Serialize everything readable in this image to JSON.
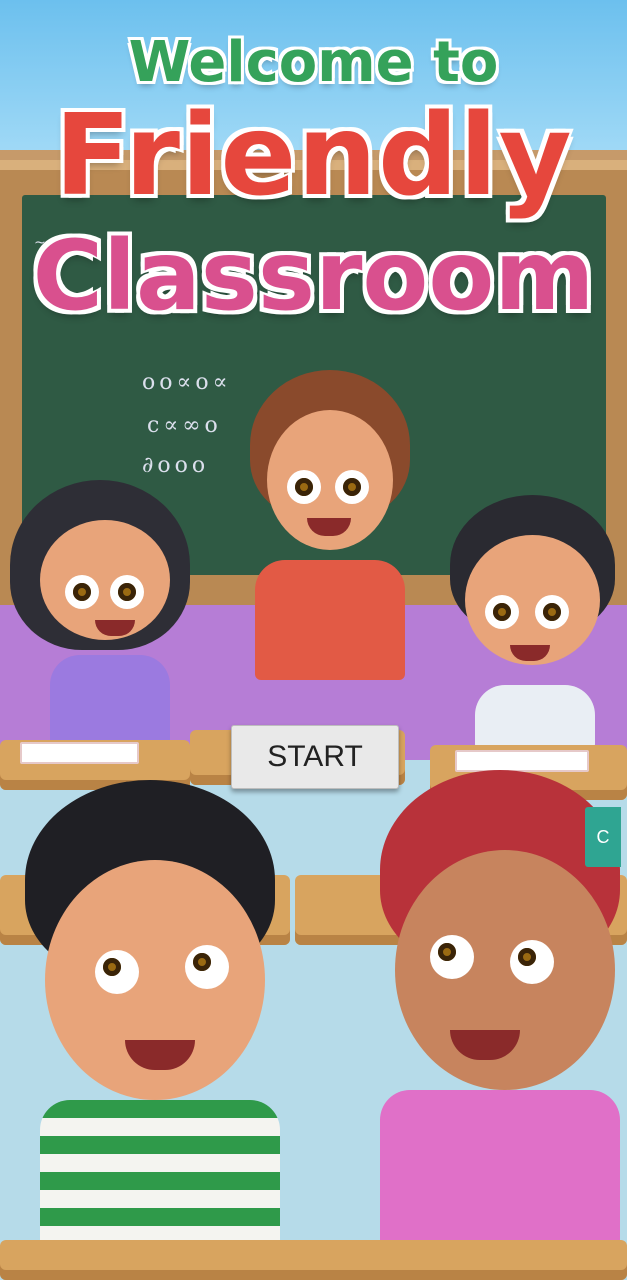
{
  "screen": {
    "title_line1": "Welcome to",
    "title_line2": "Friendly",
    "title_line3": "Classroom"
  },
  "actions": {
    "start_label": "START",
    "side_label": "C"
  },
  "colors": {
    "start_button_bg": "#e9e9e9",
    "side_button_bg": "#2fa592"
  }
}
